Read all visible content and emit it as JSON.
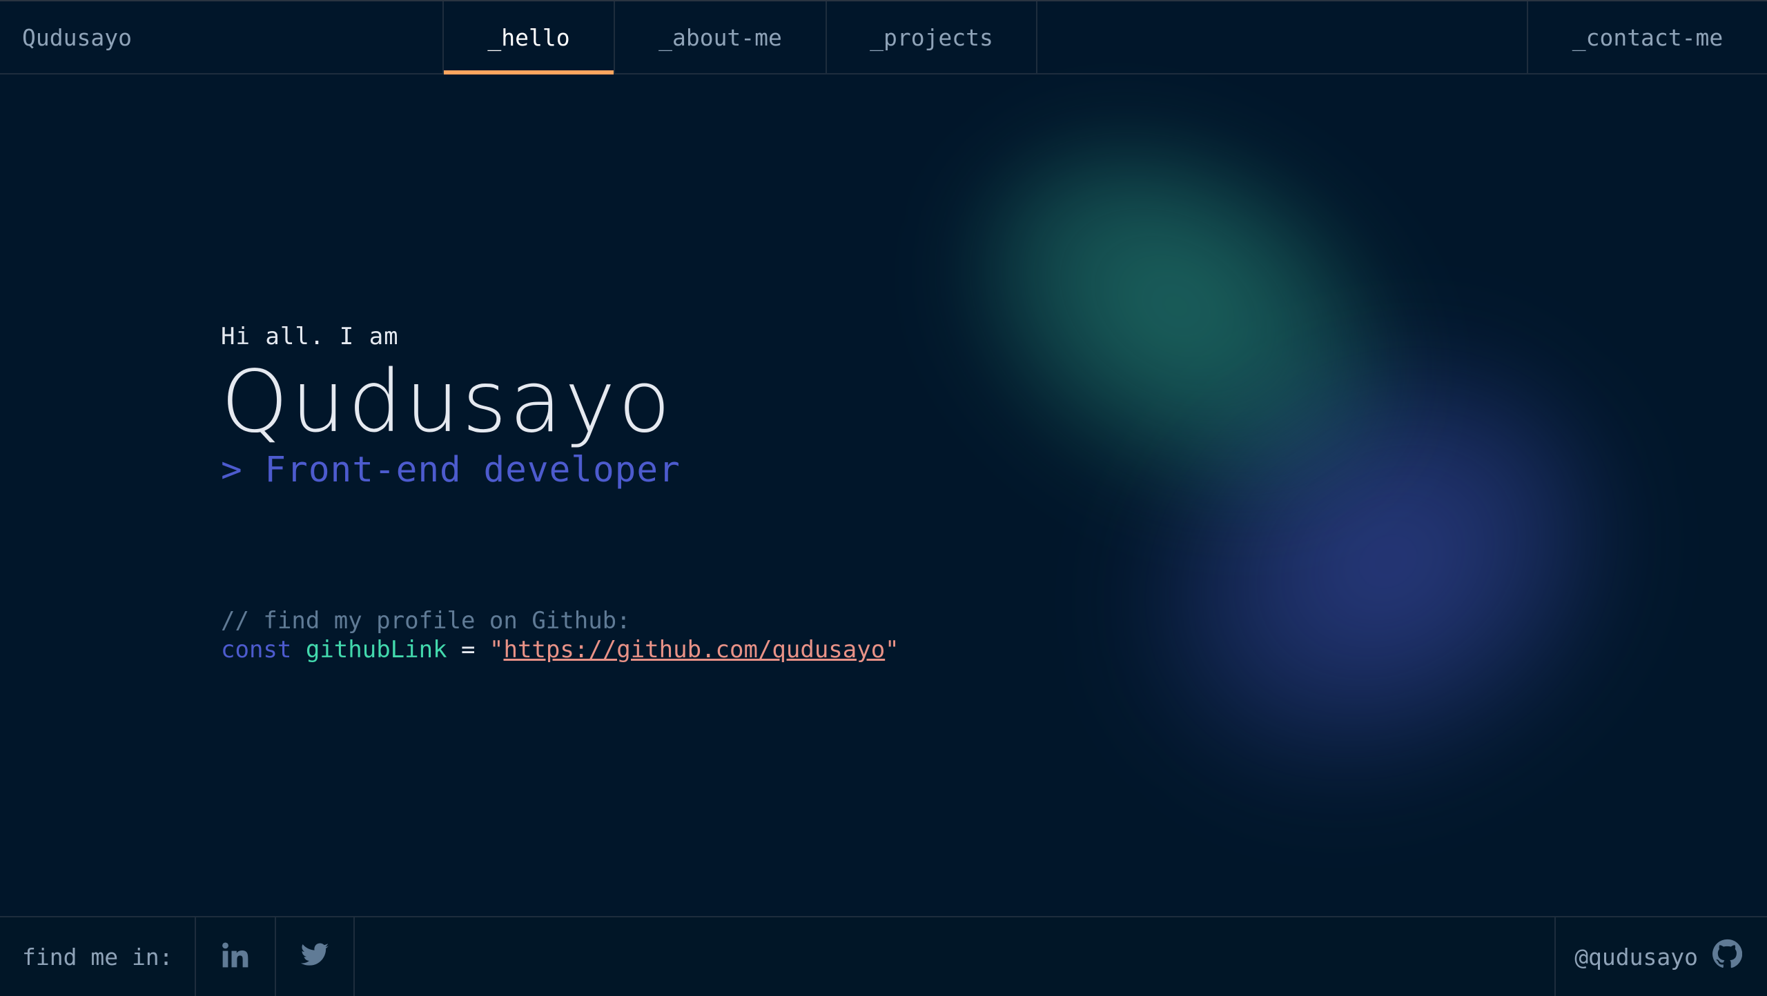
{
  "header": {
    "brand": "Qudusayo",
    "tabs": [
      {
        "label": "_hello",
        "active": true
      },
      {
        "label": "_about-me",
        "active": false
      },
      {
        "label": "_projects",
        "active": false
      }
    ],
    "contact": "_contact-me"
  },
  "hero": {
    "greeting": "Hi all. I am",
    "name": "Qudusayo",
    "role": "> Front-end developer"
  },
  "code": {
    "comment": "// find my profile on Github:",
    "keyword": "const",
    "variable": "githubLink",
    "operator": "=",
    "quote": "\"",
    "link": "https://github.com/qudusayo"
  },
  "footer": {
    "find_label": "find me in:",
    "socials": [
      {
        "icon": "linkedin-icon"
      },
      {
        "icon": "twitter-icon"
      }
    ],
    "handle": "@qudusayo",
    "handle_icon": "github-icon"
  },
  "colors": {
    "background": "#011627",
    "accent_orange": "#fea55f",
    "accent_green": "#43d9ad",
    "accent_purple": "#4d5bce",
    "string": "#e99287",
    "muted": "#607b96"
  }
}
